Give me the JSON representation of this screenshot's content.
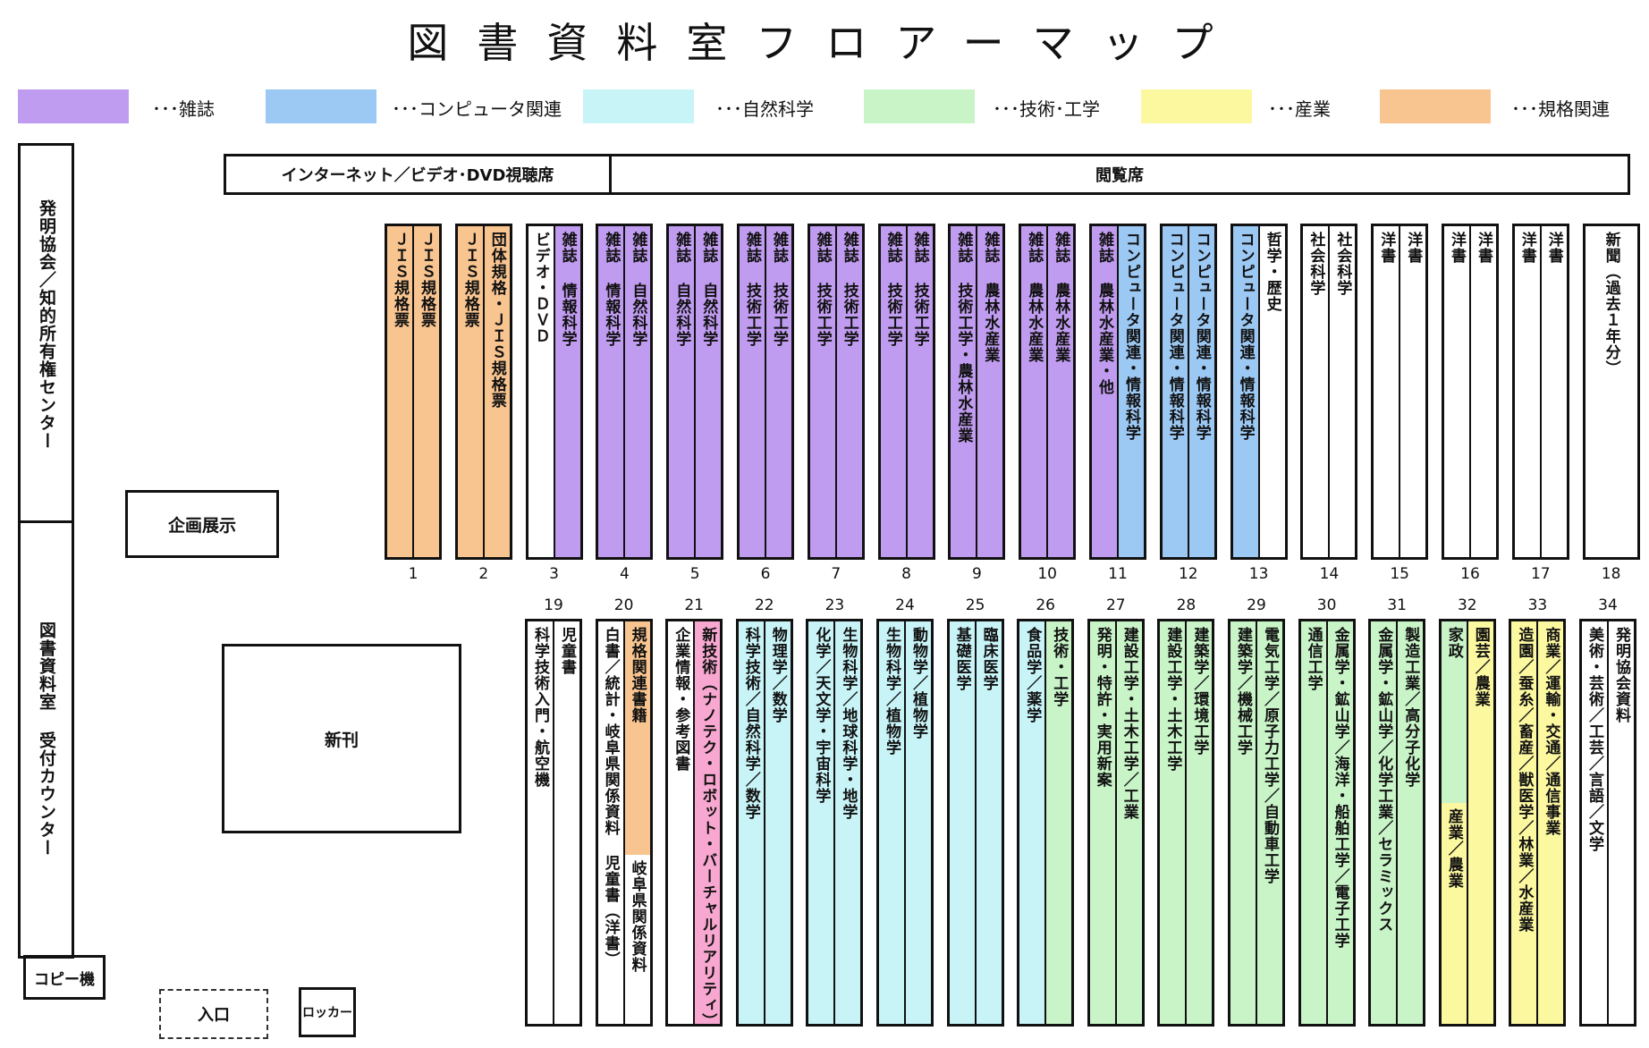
{
  "title": "図書資料室フロアーマップ",
  "legend": [
    {
      "label": "･･･雑誌",
      "color": "#c09cf0"
    },
    {
      "label": "･･･コンピュータ関連",
      "color": "#9cc8f4"
    },
    {
      "label": "･･･自然科学",
      "color": "#c8f4f8"
    },
    {
      "label": "･･･技術･工学",
      "color": "#c8f4c8"
    },
    {
      "label": "･･･産業",
      "color": "#fcf8a0"
    },
    {
      "label": "･･･規格関連",
      "color": "#f8c490"
    }
  ],
  "colors": {
    "magazine": "#c09cf0",
    "computer": "#9cc8f4",
    "science": "#c8f4f8",
    "tech": "#c8f4c8",
    "industry": "#fcf8a0",
    "standards": "#f8c490",
    "nanotech": "#f8a8d0",
    "none": "#ffffff"
  },
  "rooms": {
    "internet": "インターネット／ビデオ･DVD視聴席",
    "reading": "閲覧席",
    "hatsumei": "発明協会／知的所有権センター",
    "counter": "図書資料室 受付カウンター",
    "kikaku": "企画展示",
    "shinkan": "新刊",
    "copy": "コピー機",
    "entrance": "入口",
    "locker": "ロッカー"
  },
  "top_shelves": [
    {
      "number": "1",
      "left": {
        "text": "ＪＩＳ規格票",
        "color": "standards"
      },
      "right": {
        "text": "ＪＩＳ規格票",
        "color": "standards"
      }
    },
    {
      "number": "2",
      "left": {
        "text": "ＪＩＳ規格票",
        "color": "standards"
      },
      "right": {
        "text": "団体規格・ＪＩＳ規格票",
        "color": "standards"
      }
    },
    {
      "number": "3",
      "left": {
        "text": "ビデオ・ＤＶＤ",
        "color": "none"
      },
      "right": {
        "text": "雑誌 情報科学",
        "color": "magazine"
      }
    },
    {
      "number": "4",
      "left": {
        "text": "雑誌 情報科学",
        "color": "magazine"
      },
      "right": {
        "text": "雑誌 自然科学",
        "color": "magazine"
      }
    },
    {
      "number": "5",
      "left": {
        "text": "雑誌 自然科学",
        "color": "magazine"
      },
      "right": {
        "text": "雑誌 自然科学",
        "color": "magazine"
      }
    },
    {
      "number": "6",
      "left": {
        "text": "雑誌 技術工学",
        "color": "magazine"
      },
      "right": {
        "text": "雑誌 技術工学",
        "color": "magazine"
      }
    },
    {
      "number": "7",
      "left": {
        "text": "雑誌 技術工学",
        "color": "magazine"
      },
      "right": {
        "text": "雑誌 技術工学",
        "color": "magazine"
      }
    },
    {
      "number": "8",
      "left": {
        "text": "雑誌 技術工学",
        "color": "magazine"
      },
      "right": {
        "text": "雑誌 技術工学",
        "color": "magazine"
      }
    },
    {
      "number": "9",
      "left": {
        "text": "雑誌 技術工学・農林水産業",
        "color": "magazine"
      },
      "right": {
        "text": "雑誌 農林水産業",
        "color": "magazine"
      }
    },
    {
      "number": "10",
      "left": {
        "text": "雑誌 農林水産業",
        "color": "magazine"
      },
      "right": {
        "text": "雑誌 農林水産業",
        "color": "magazine"
      }
    },
    {
      "number": "11",
      "left": {
        "text": "雑誌 農林水産業・他",
        "color": "magazine"
      },
      "right": {
        "text": "コンピュータ関連・情報科学",
        "color": "computer"
      }
    },
    {
      "number": "12",
      "left": {
        "text": "コンピュータ関連・情報科学",
        "color": "computer"
      },
      "right": {
        "text": "コンピュータ関連・情報科学",
        "color": "computer"
      }
    },
    {
      "number": "13",
      "left": {
        "text": "コンピュータ関連・情報科学",
        "color": "computer"
      },
      "right": {
        "text": "哲学・歴史",
        "color": "none"
      }
    },
    {
      "number": "14",
      "left": {
        "text": "社会科学",
        "color": "none"
      },
      "right": {
        "text": "社会科学",
        "color": "none"
      }
    },
    {
      "number": "15",
      "left": {
        "text": "洋書",
        "color": "none"
      },
      "right": {
        "text": "洋書",
        "color": "none"
      }
    },
    {
      "number": "16",
      "left": {
        "text": "洋書",
        "color": "none"
      },
      "right": {
        "text": "洋書",
        "color": "none"
      }
    },
    {
      "number": "17",
      "left": {
        "text": "洋書",
        "color": "none"
      },
      "right": {
        "text": "洋書",
        "color": "none"
      }
    },
    {
      "number": "18",
      "full": {
        "text": "新聞（過去１年分）",
        "color": "none"
      }
    }
  ],
  "bottom_shelves": [
    {
      "number": "19",
      "left": {
        "text": "科学技術入門・航空機",
        "color": "none"
      },
      "right": {
        "text": "児童書",
        "color": "none"
      }
    },
    {
      "number": "20",
      "left": {
        "text": "白書／統計・岐阜県関係資料 児童書（洋書）",
        "color": "none"
      },
      "right_top": {
        "text": "規格関連書籍",
        "color": "standards"
      },
      "right_bottom": {
        "text": "岐阜県関係資料",
        "color": "none"
      }
    },
    {
      "number": "21",
      "left": {
        "text": "企業情報・参考図書",
        "color": "none"
      },
      "right": {
        "text": "新技術（ナノテク・ロボット・バーチャルリアリティ）",
        "color": "nanotech"
      }
    },
    {
      "number": "22",
      "left": {
        "text": "科学技術／自然科学／数学",
        "color": "science"
      },
      "right": {
        "text": "物理学／数学",
        "color": "science"
      }
    },
    {
      "number": "23",
      "left": {
        "text": "化学／天文学・宇宙科学",
        "color": "science"
      },
      "right": {
        "text": "生物科学／地球科学・地学",
        "color": "science"
      }
    },
    {
      "number": "24",
      "left": {
        "text": "生物科学／植物学",
        "color": "science"
      },
      "right": {
        "text": "動物学／植物学",
        "color": "science"
      }
    },
    {
      "number": "25",
      "left": {
        "text": "基礎医学",
        "color": "science"
      },
      "right": {
        "text": "臨床医学",
        "color": "science"
      }
    },
    {
      "number": "26",
      "left": {
        "text": "食品学／薬学",
        "color": "science"
      },
      "right": {
        "text": "技術・工学",
        "color": "tech"
      }
    },
    {
      "number": "27",
      "left": {
        "text": "発明・特許・実用新案",
        "color": "tech"
      },
      "right": {
        "text": "建設工学・土木工学／工業",
        "color": "tech"
      }
    },
    {
      "number": "28",
      "left": {
        "text": "建設工学・土木工学",
        "color": "tech"
      },
      "right": {
        "text": "建築学／環境工学",
        "color": "tech"
      }
    },
    {
      "number": "29",
      "left": {
        "text": "建築学／機械工学",
        "color": "tech"
      },
      "right": {
        "text": "電気工学／原子力工学／自動車工学",
        "color": "tech"
      }
    },
    {
      "number": "30",
      "left": {
        "text": "通信工学",
        "color": "tech"
      },
      "right": {
        "text": "金属学・鉱山学／海洋・船舶工学／電子工学",
        "color": "tech"
      }
    },
    {
      "number": "31",
      "left": {
        "text": "金属学・鉱山学／化学工業／セラミックス",
        "color": "tech"
      },
      "right": {
        "text": "製造工業／高分子化学",
        "color": "tech"
      }
    },
    {
      "number": "32",
      "left_top": {
        "text": "家政",
        "color": "tech"
      },
      "left_bottom": {
        "text": "産業／農業",
        "color": "industry"
      },
      "right": {
        "text": "園芸／農業",
        "color": "industry"
      }
    },
    {
      "number": "33",
      "left": {
        "text": "造園／蚕糸／畜産／獣医学／林業／水産業",
        "color": "industry"
      },
      "right": {
        "text": "商業／運輸・交通／通信事業",
        "color": "industry"
      }
    },
    {
      "number": "34",
      "left": {
        "text": "美術・芸術／工芸／言語／文学",
        "color": "none"
      },
      "right": {
        "text": "発明協会資料",
        "color": "none"
      }
    }
  ]
}
